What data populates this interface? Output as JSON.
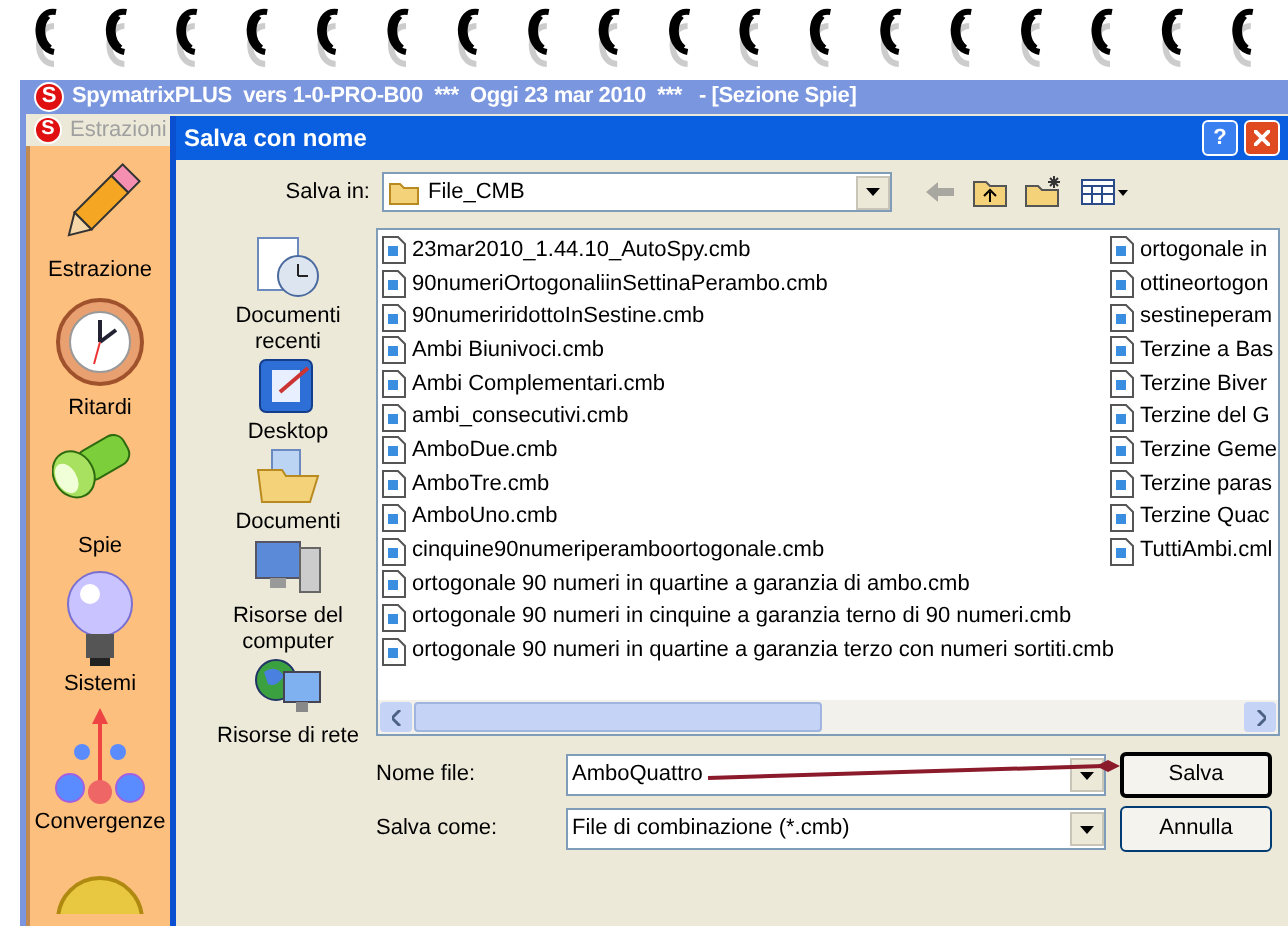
{
  "app": {
    "logo": "S",
    "title": "SpymatrixPLUS  vers 1-0-PRO-B00  ***  Oggi 23 mar 2010  ***   - [Sezione Spie]",
    "menu_logo": "S",
    "menu": [
      {
        "label": "Estrazioni",
        "disabled": true
      }
    ],
    "sidebar": [
      {
        "kind": "pencil",
        "label": "Estrazione"
      },
      {
        "kind": "clock",
        "label": "Ritardi"
      },
      {
        "kind": "flashlight",
        "label": "Spie"
      },
      {
        "kind": "bulb",
        "label": "Sistemi"
      },
      {
        "kind": "tree",
        "label": "Convergenze"
      },
      {
        "kind": "coin"
      }
    ]
  },
  "dialog": {
    "title": "Salva con nome",
    "help": "?",
    "save_in": {
      "label": "Salva in:",
      "value": "File_CMB"
    },
    "places": [
      {
        "kind": "recent",
        "label": "Documenti recenti"
      },
      {
        "kind": "desktop",
        "label": "Desktop"
      },
      {
        "kind": "documents",
        "label": "Documenti"
      },
      {
        "kind": "computer",
        "label": "Risorse del computer"
      },
      {
        "kind": "network",
        "label": "Risorse di rete"
      }
    ],
    "files": [
      [
        "23mar2010_1.44.10_AutoSpy.cmb",
        "90numeriOrtogonaliinSettinaPerambo.cmb",
        "90numeriridottoInSestine.cmb",
        "Ambi Biunivoci.cmb",
        "Ambi Complementari.cmb",
        "ambi_consecutivi.cmb",
        "AmboDue.cmb",
        "AmboTre.cmb",
        "AmboUno.cmb",
        "cinquine90numeriperamboortogonale.cmb",
        "ortogonale 90 numeri  in quartine a garanzia di ambo.cmb",
        "ortogonale 90 numeri in cinquine a garanzia terno di 90 numeri.cmb",
        "ortogonale 90 numeri in quartine a garanzia terzo con  numeri sortiti.cmb"
      ],
      [
        "ortogonale in",
        "ottineortogon",
        "sestineperam",
        "Terzine a Bas",
        "Terzine Biver",
        "Terzine del G",
        "Terzine Geme",
        "Terzine paras",
        "Terzine Quac",
        "TuttiAmbi.cml"
      ]
    ],
    "file_name": {
      "label": "Nome file:",
      "value": "AmboQuattro"
    },
    "save_as": {
      "label": "Salva come:",
      "value": "File di combinazione (*.cmb)"
    },
    "buttons": [
      {
        "label": "Salva",
        "default": true
      },
      {
        "label": "Annulla",
        "default": false
      }
    ]
  }
}
